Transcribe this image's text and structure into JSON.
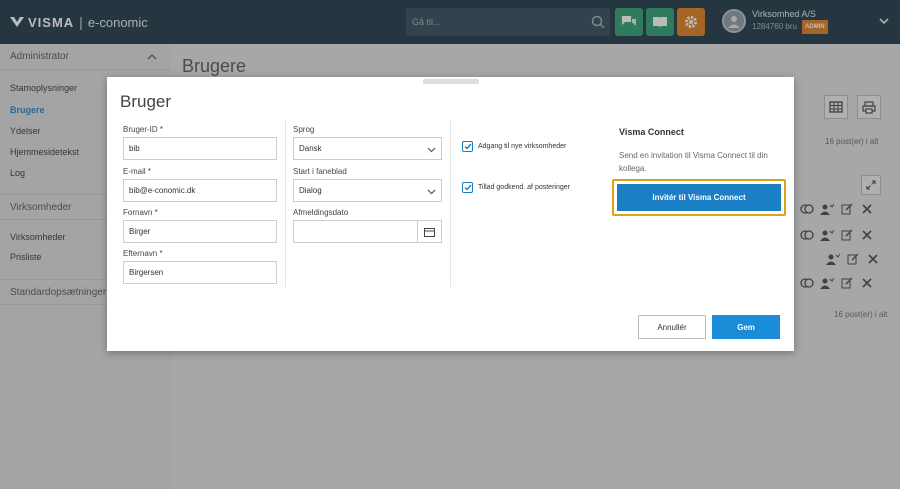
{
  "header": {
    "brand": "VISMA",
    "separator": "|",
    "product": "e-conomic",
    "search_placeholder": "Gå til...",
    "company_name": "Virksomhed A/S",
    "company_user": "1284760 bru",
    "role_badge": "ADMIN",
    "accent_green": "#2a9d70",
    "accent_orange": "#e07b1a"
  },
  "sidebar": {
    "section_admin": "Administrator",
    "admin_items": [
      "Stamoplysninger",
      "Brugere",
      "Ydelser",
      "Hjemmesidetekst",
      "Log"
    ],
    "section_companies": "Virksomheder",
    "company_items": [
      "Virksomheder",
      "Prisliste"
    ],
    "section_default": "Standardopsætninger"
  },
  "main": {
    "page_title": "Brugere",
    "post_count_top": "16 post(er) i alt",
    "post_count_bottom": "16 post(er) i alt"
  },
  "modal": {
    "title": "Bruger",
    "fields": {
      "user_id_label": "Bruger-ID *",
      "user_id_value": "bib",
      "email_label": "E-mail *",
      "email_value": "bib@e-conomic.dk",
      "firstname_label": "Fornavn *",
      "firstname_value": "Birger",
      "lastname_label": "Efternavn *",
      "lastname_value": "Birgersen",
      "language_label": "Sprog",
      "language_value": "Dansk",
      "start_tab_label": "Start i faneblad",
      "start_tab_value": "Dialog",
      "unsubscribe_label": "Afmeldingsdato",
      "unsubscribe_value": ""
    },
    "checks": {
      "access_new_companies": "Adgang til nye virksomheder",
      "allow_approve_postings": "Tillad godkend. af posteringer"
    },
    "visma_connect": {
      "title": "Visma Connect",
      "description": "Send en invitation til Visma Connect til din kollega.",
      "invite_label": "Invitér til Visma Connect"
    },
    "buttons": {
      "cancel": "Annullér",
      "save": "Gem"
    }
  }
}
